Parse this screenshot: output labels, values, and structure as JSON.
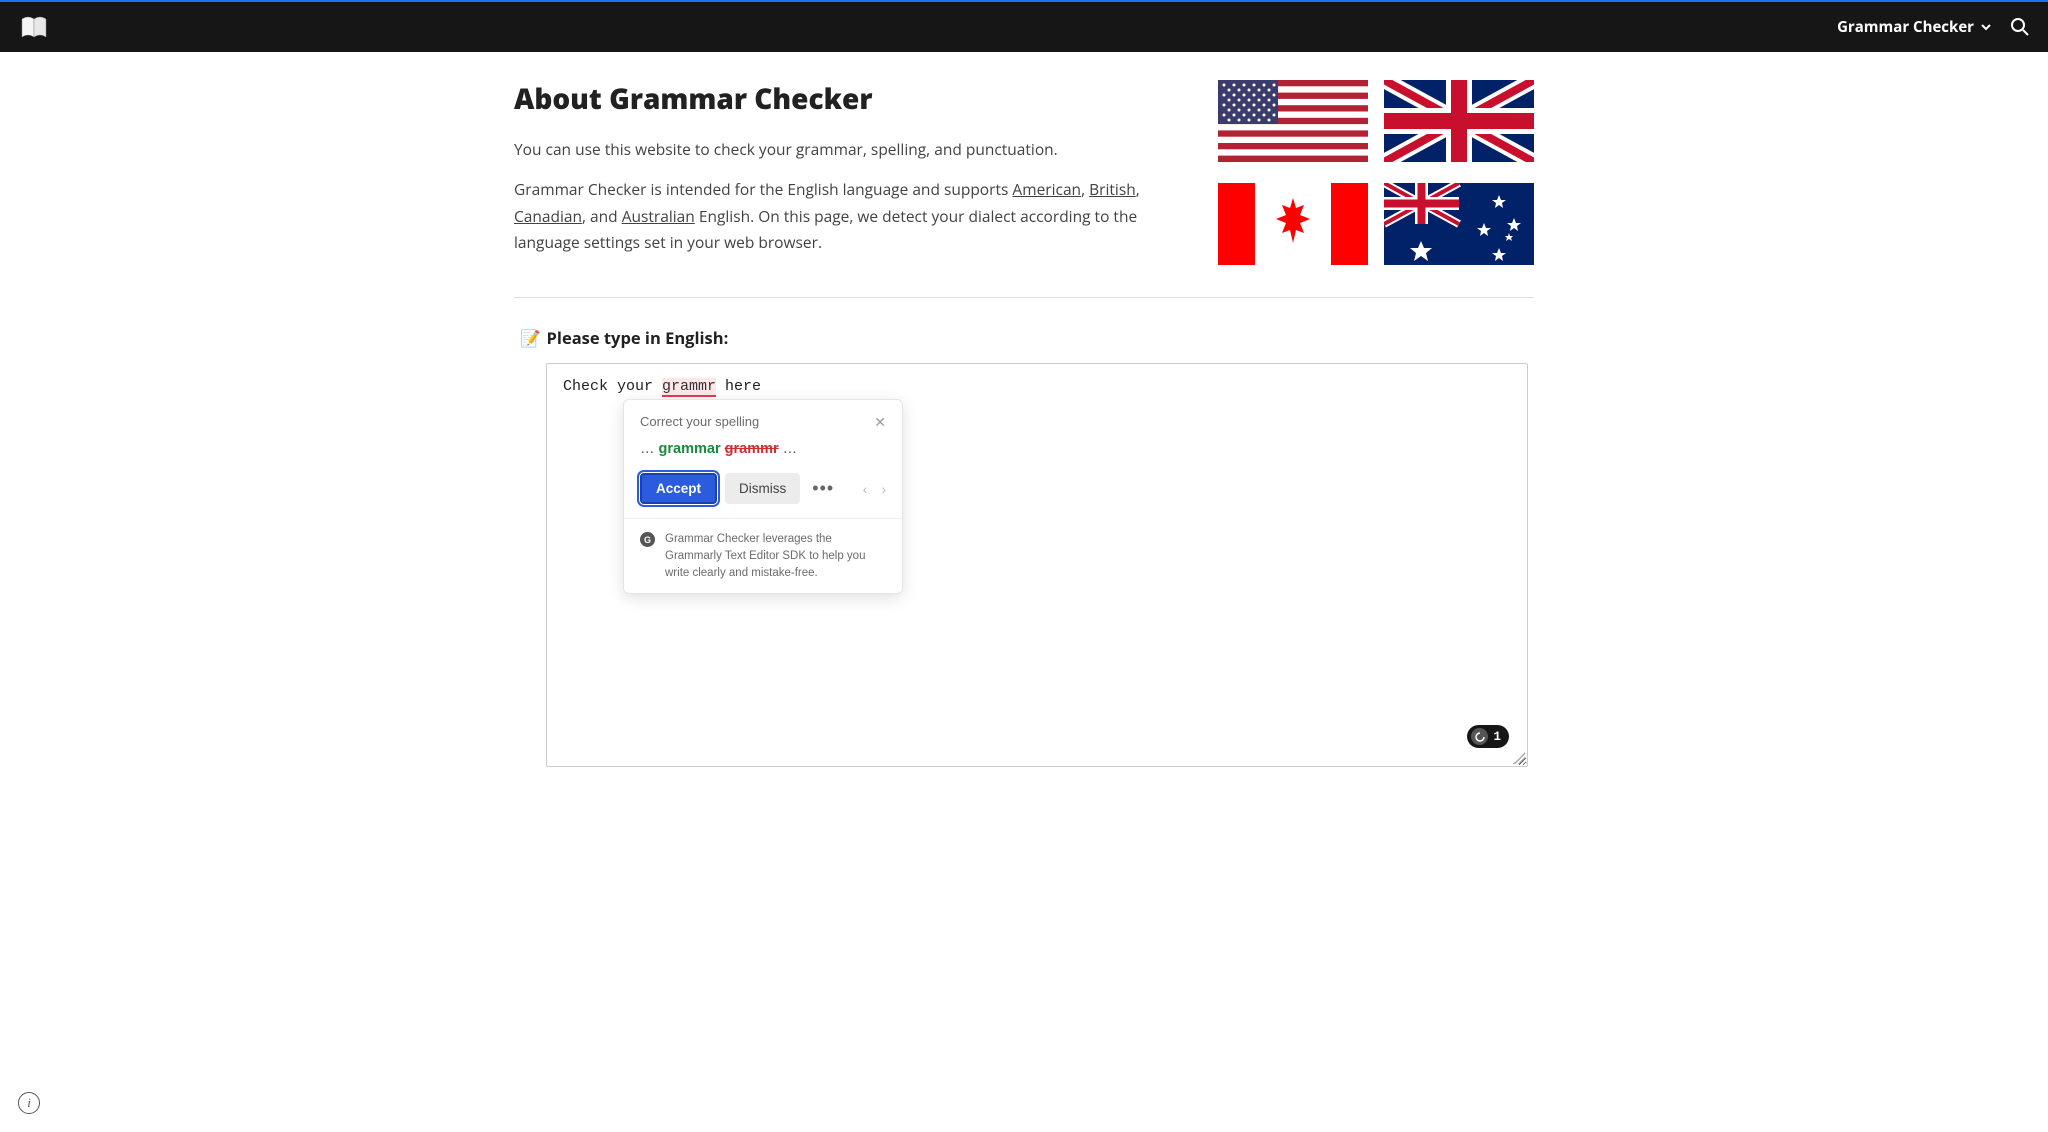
{
  "header": {
    "nav_label": "Grammar Checker"
  },
  "about": {
    "title": "About Grammar Checker",
    "p1": "You can use this website to check your grammar, spelling, and punctuation.",
    "p2_a": "Grammar Checker is intended for the English language and supports ",
    "link_american": "American",
    "sep1": ", ",
    "link_british": "British",
    "sep2": ", ",
    "link_canadian": "Canadian",
    "sep3": ", and ",
    "link_australian": "Australian",
    "p2_b": " English. On this page, we detect your dialect according to the language settings set in your web browser."
  },
  "editor": {
    "heading": "Please type in English:",
    "text_before": "Check your ",
    "text_misspell": "grammr",
    "text_after": " here"
  },
  "popup": {
    "title": "Correct your spelling",
    "ellipsis1": "… ",
    "correct": "grammar",
    "wrong": "grammr",
    "ellipsis2": " …",
    "accept": "Accept",
    "dismiss": "Dismiss",
    "footer": "Grammar Checker leverages the Grammarly Text Editor SDK to help you write clearly and mistake-free."
  },
  "badge": {
    "count": "1"
  },
  "icons": {
    "memo": "📝"
  }
}
